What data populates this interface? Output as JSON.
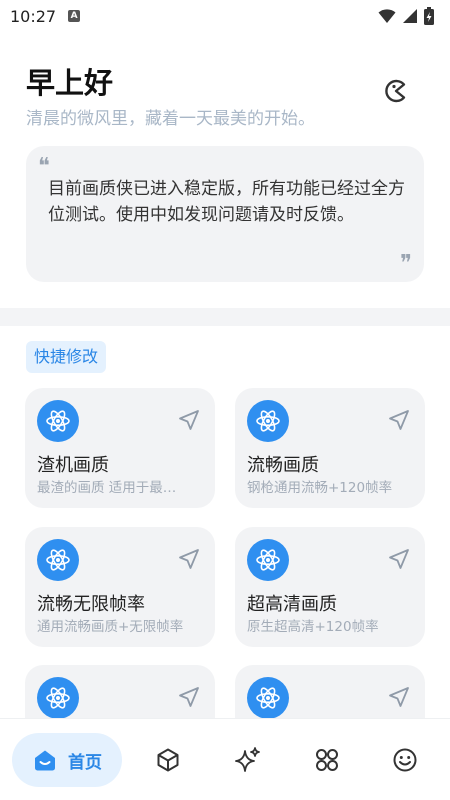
{
  "status_bar": {
    "time": "10:27",
    "notification_icon": "a-icon",
    "wifi_icon": "wifi-icon",
    "signal_icon": "signal-icon",
    "battery_icon": "battery-charging-icon"
  },
  "header": {
    "greeting": "早上好",
    "subtitle": "清晨的微风里，藏着一天最美的开始。",
    "theme_icon": "moon-toggle-icon"
  },
  "notice": {
    "text": "目前画质侠已进入稳定版，所有功能已经过全方位测试。使用中如发现问题请及时反馈。",
    "quote_open": "❝",
    "quote_close": "❞"
  },
  "section": {
    "label": "快捷修改"
  },
  "cards": [
    {
      "title": "渣机画质",
      "desc": "最渣的画质 适用于最…",
      "icon": "atom-icon"
    },
    {
      "title": "流畅画质",
      "desc": "钢枪通用流畅+120帧率",
      "icon": "atom-icon"
    },
    {
      "title": "流畅无限帧率",
      "desc": "通用流畅画质+无限帧率",
      "icon": "atom-icon"
    },
    {
      "title": "超高清画质",
      "desc": "原生超高清+120帧率",
      "icon": "atom-icon"
    },
    {
      "title": "",
      "desc": "",
      "icon": "atom-icon"
    },
    {
      "title": "",
      "desc": "",
      "icon": "atom-icon"
    }
  ],
  "bottom_nav": {
    "home_label": "首页",
    "items": [
      "home-icon",
      "cube-icon",
      "sparkle-icon",
      "apps-grid-icon",
      "smile-icon"
    ]
  },
  "colors": {
    "accent": "#2f8ff0",
    "accent_soft": "#e4f1fe",
    "card_bg": "#f2f3f5",
    "subtitle": "#a9b7c7"
  }
}
